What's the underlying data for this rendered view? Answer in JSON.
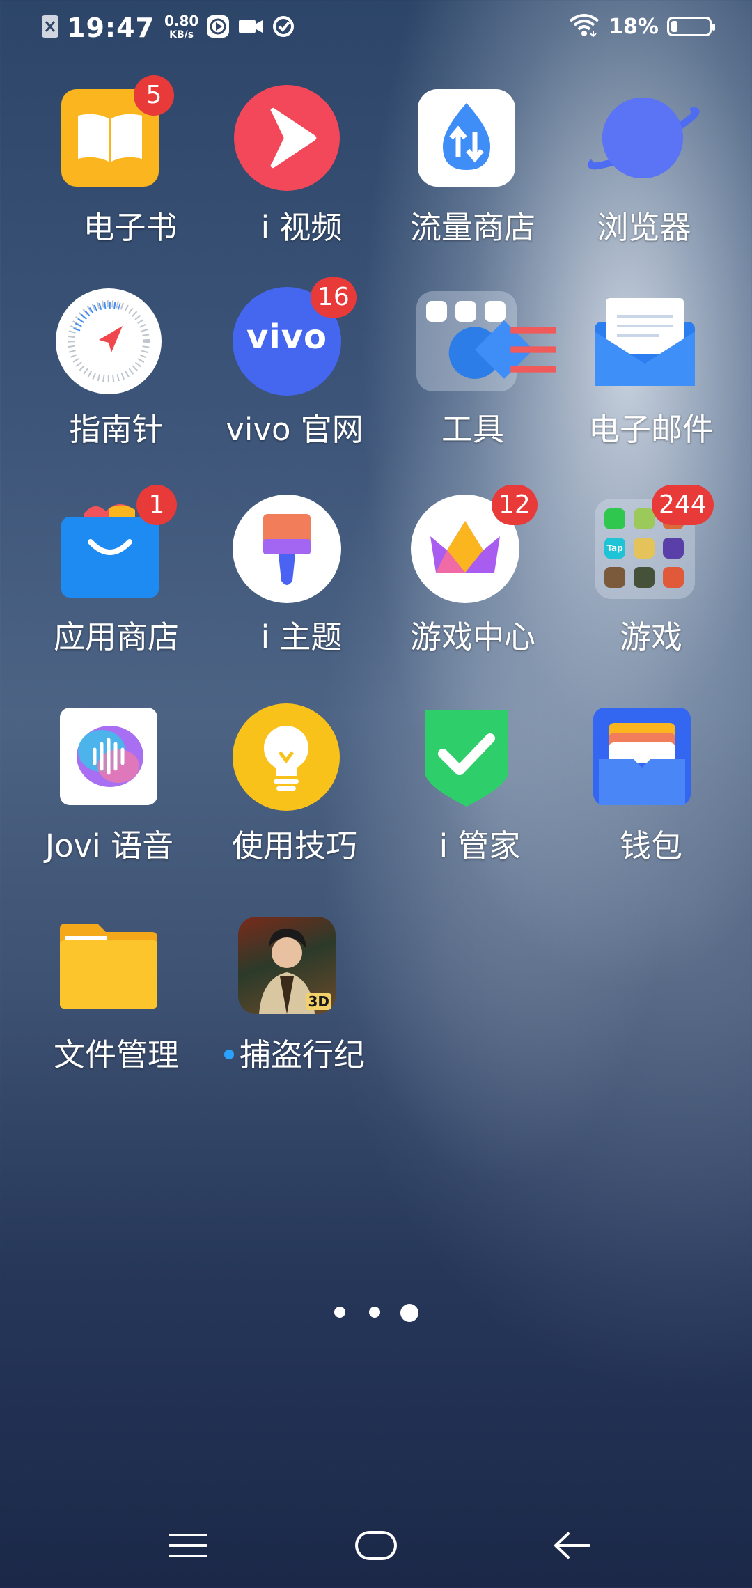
{
  "status_bar": {
    "time": "19:47",
    "net_speed_value": "0.80",
    "net_speed_unit": "KB/s",
    "battery_percent": "18%",
    "battery_level": 0.18,
    "icons": [
      "notification-muted-icon",
      "play-icon",
      "video-camera-icon",
      "sync-icon",
      "wifi-icon",
      "battery-icon"
    ]
  },
  "apps": [
    {
      "label": "电子书",
      "badge": "5",
      "icon": "ebook-icon"
    },
    {
      "label": "i 视频",
      "badge": "",
      "icon": "video-play-icon"
    },
    {
      "label": "流量商店",
      "badge": "",
      "icon": "data-store-icon"
    },
    {
      "label": "浏览器",
      "badge": "",
      "icon": "browser-planet-icon"
    },
    {
      "label": "指南针",
      "badge": "",
      "icon": "compass-icon"
    },
    {
      "label": "vivo 官网",
      "badge": "16",
      "icon": "vivo-logo-icon",
      "logo_text": "vivo"
    },
    {
      "label": "工具",
      "badge": "",
      "icon": "tools-folder-icon"
    },
    {
      "label": "电子邮件",
      "badge": "",
      "icon": "email-envelope-icon"
    },
    {
      "label": "应用商店",
      "badge": "1",
      "icon": "app-store-bag-icon"
    },
    {
      "label": "i 主题",
      "badge": "",
      "icon": "theme-brush-icon"
    },
    {
      "label": "游戏中心",
      "badge": "12",
      "icon": "game-center-crown-icon"
    },
    {
      "label": "游戏",
      "badge": "244",
      "icon": "games-folder-icon",
      "folder_text": "Tap"
    },
    {
      "label": "Jovi 语音",
      "badge": "",
      "icon": "jovi-voice-icon"
    },
    {
      "label": "使用技巧",
      "badge": "",
      "icon": "tips-lightbulb-icon"
    },
    {
      "label": "i 管家",
      "badge": "",
      "icon": "security-shield-icon"
    },
    {
      "label": "钱包",
      "badge": "",
      "icon": "wallet-icon"
    },
    {
      "label": "文件管理",
      "badge": "",
      "icon": "file-folder-icon"
    },
    {
      "label": "捕盗行纪",
      "badge": "",
      "icon": "game-character-icon",
      "new_install": true,
      "icon_text": "3D"
    }
  ],
  "page_indicator": {
    "pages": 3,
    "current": 3
  },
  "nav_bar": {
    "icons": [
      "menu-icon",
      "home-icon",
      "back-icon"
    ]
  },
  "colors": {
    "badge": "#e93a3a",
    "new_dot": "#29a3ff"
  }
}
